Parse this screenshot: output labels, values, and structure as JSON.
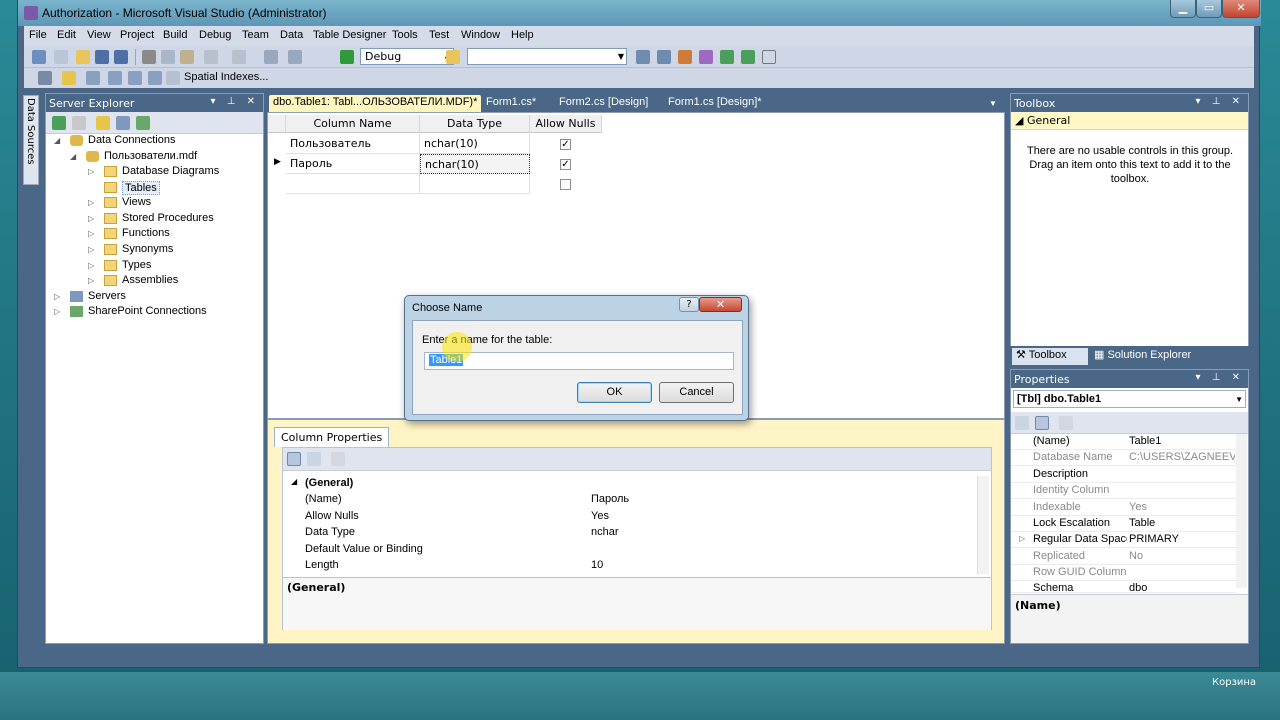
{
  "window": {
    "title": "Authorization - Microsoft Visual Studio (Administrator)",
    "close_glyph": "✕"
  },
  "menu": [
    "File",
    "Edit",
    "View",
    "Project",
    "Build",
    "Debug",
    "Team",
    "Data",
    "Table Designer",
    "Tools",
    "Test",
    "Window",
    "Help"
  ],
  "toolbar": {
    "config": "Debug",
    "spatial_indexes": "Spatial Indexes..."
  },
  "side_tab": {
    "label": "Data Sources"
  },
  "server_explorer": {
    "title": "Server Explorer",
    "tree": [
      {
        "label": "Data Connections",
        "arrow": "◢"
      },
      {
        "label": "Пользователи.mdf",
        "arrow": "◢"
      },
      {
        "label": "Database Diagrams",
        "arrow": "▷"
      },
      {
        "label": "Tables",
        "arrow": ""
      },
      {
        "label": "Views",
        "arrow": "▷"
      },
      {
        "label": "Stored Procedures",
        "arrow": "▷"
      },
      {
        "label": "Functions",
        "arrow": "▷"
      },
      {
        "label": "Synonyms",
        "arrow": "▷"
      },
      {
        "label": "Types",
        "arrow": "▷"
      },
      {
        "label": "Assemblies",
        "arrow": "▷"
      },
      {
        "label": "Servers",
        "arrow": "▷"
      },
      {
        "label": "SharePoint Connections",
        "arrow": "▷"
      }
    ]
  },
  "tabs": [
    "dbo.Table1: Tabl...ОЛЬЗОВАТЕЛИ.MDF)*",
    "Form1.cs*",
    "Form2.cs [Design]",
    "Form1.cs [Design]*"
  ],
  "table_designer": {
    "headers": [
      "Column Name",
      "Data Type",
      "Allow Nulls"
    ],
    "rows": [
      {
        "name": "Пользователь",
        "type": "nchar(10)",
        "allow_nulls": "✓"
      },
      {
        "name": "Пароль",
        "type": "nchar(10)",
        "allow_nulls": "✓"
      },
      {
        "name": "",
        "type": "",
        "allow_nulls": ""
      }
    ],
    "row_pointer": "▶"
  },
  "column_properties": {
    "tab": "Column Properties",
    "rows": [
      {
        "name": "(General)",
        "value": ""
      },
      {
        "name": "(Name)",
        "value": "Пароль"
      },
      {
        "name": "Allow Nulls",
        "value": "Yes"
      },
      {
        "name": "Data Type",
        "value": "nchar"
      },
      {
        "name": "Default Value or Binding",
        "value": ""
      },
      {
        "name": "Length",
        "value": "10"
      }
    ],
    "desc_title": "(General)"
  },
  "toolbox": {
    "title": "Toolbox",
    "group": "◢ General",
    "message": "There are no usable controls in this group. Drag an item onto this text to add it to the toolbox.",
    "bottom_tabs": [
      "Toolbox",
      "Solution Explorer"
    ]
  },
  "properties": {
    "title": "Properties",
    "object": "[Tbl] dbo.Table1",
    "rows": [
      {
        "name": "(Name)",
        "value": "Table1"
      },
      {
        "name": "Database Name",
        "value": "C:\\USERS\\ZAGNEEV\\DO"
      },
      {
        "name": "Description",
        "value": ""
      },
      {
        "name": "Identity Column",
        "value": ""
      },
      {
        "name": "Indexable",
        "value": "Yes"
      },
      {
        "name": "Lock Escalation",
        "value": "Table"
      },
      {
        "name": "Regular Data Space S",
        "value": "PRIMARY"
      },
      {
        "name": "Replicated",
        "value": "No"
      },
      {
        "name": "Row GUID Column",
        "value": ""
      },
      {
        "name": "Schema",
        "value": "dbo"
      }
    ],
    "desc_title": "(Name)"
  },
  "dialog": {
    "title": "Choose Name",
    "help": "?",
    "close": "✕",
    "prompt": "Enter a name for the table:",
    "input_value": "Table1",
    "ok": "OK",
    "cancel": "Cancel"
  },
  "desktop": {
    "recycle_bin": "Корзина"
  }
}
